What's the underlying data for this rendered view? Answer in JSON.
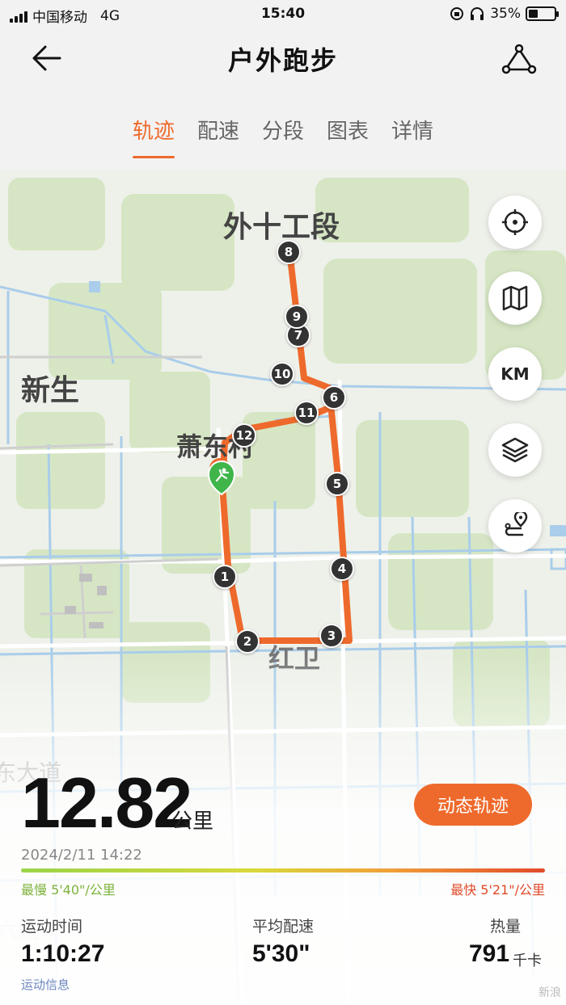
{
  "status_bar": {
    "carrier": "中国移动",
    "network": "4G",
    "time": "15:40",
    "battery": "35%",
    "battery_level": 0.35
  },
  "header": {
    "title": "户外跑步",
    "back_icon": "arrow-left-icon",
    "route_icon": "route-share-icon"
  },
  "tabs": [
    {
      "label": "轨迹",
      "active": true
    },
    {
      "label": "配速",
      "active": false
    },
    {
      "label": "分段",
      "active": false
    },
    {
      "label": "图表",
      "active": false
    },
    {
      "label": "详情",
      "active": false
    }
  ],
  "map": {
    "labels": [
      "外十工段",
      "新生",
      "萧东村",
      "红卫",
      "东大道",
      "六路"
    ],
    "km_markers": [
      "1",
      "2",
      "3",
      "4",
      "5",
      "6",
      "7",
      "8",
      "9",
      "10",
      "11",
      "12"
    ],
    "controls": {
      "locate_icon": "crosshair-icon",
      "map_icon": "map-icon",
      "km_label": "KM",
      "layers_icon": "layers-icon",
      "route_pin_icon": "route-pin-icon"
    },
    "colors": {
      "route": "#ee6a2c",
      "start": "#3fb54a",
      "marker": "#333333"
    }
  },
  "summary": {
    "distance": "12.82",
    "distance_unit": "公里",
    "dynamic_button": "动态轨迹",
    "datetime": "2024/2/11 14:22",
    "slowest": "最慢 5'40\"/公里",
    "fastest": "最快 5'21\"/公里",
    "stats": [
      {
        "label": "运动时间",
        "value": "1:10:27",
        "unit": ""
      },
      {
        "label": "平均配速",
        "value": "5'30\"",
        "unit": ""
      },
      {
        "label": "热量",
        "value": "791",
        "unit": "千卡"
      }
    ],
    "detail_link": "运动信息",
    "watermark": "新浪"
  }
}
